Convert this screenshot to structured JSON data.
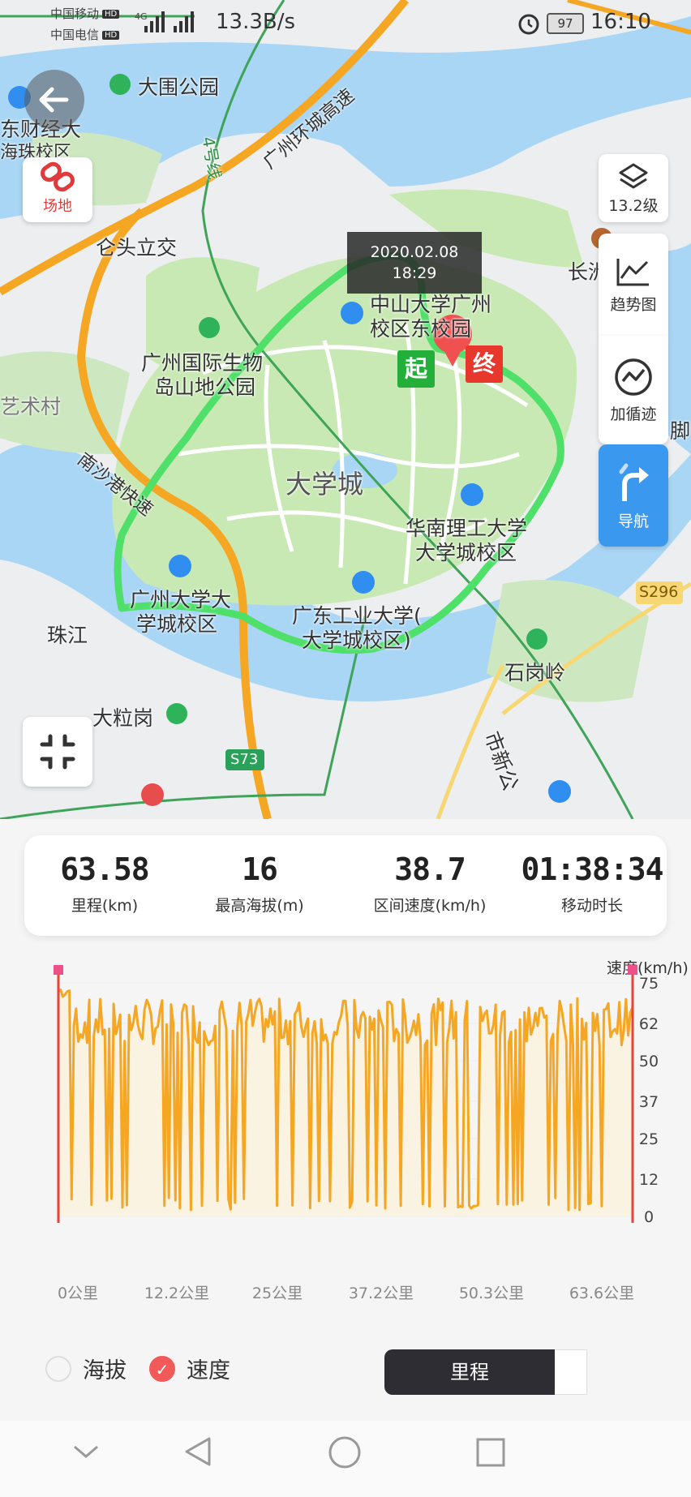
{
  "status_bar": {
    "carrier1": "中国移动",
    "carrier2": "中国电信",
    "hd": "HD",
    "net": "4G",
    "speed": "13.3B/s",
    "battery": "97",
    "time": "16:10"
  },
  "map": {
    "labels": {
      "park": "大围公园",
      "finance_school": "东财经大",
      "finance_school2": "海珠校区",
      "expressway": "广州环城高速",
      "metro4": "4号线",
      "interchange": "仑头立交",
      "biopark": "广州国际生物",
      "biopark2": "岛山地公园",
      "art_village": "艺术村",
      "nansha": "南沙港快速",
      "daxuecheng": "大学城",
      "scut": "华南理工大学",
      "scut2": "大学城校区",
      "gzhu": "广州大学大",
      "gzhu2": "学城校区",
      "gdut": "广东工业大学(",
      "gdut2": "大学城校区)",
      "sysu": "中山大学广州",
      "sysu2": "校区东校园",
      "pearl_river": "珠江",
      "daligang": "大粒岗",
      "shigangling": "石岗岭",
      "city_road": "市新公",
      "changzhou": "长洲",
      "jiao": "脚",
      "s73": "S73",
      "s296": "S296"
    },
    "venue_button_label": "场地",
    "tooltip_date": "2020.02.08",
    "tooltip_time": "18:29",
    "start_tag": "起",
    "end_tag": "终",
    "zoom_level": "13.2级",
    "panel": {
      "trend": "趋势图",
      "loop": "加循迹",
      "nav": "导航"
    }
  },
  "stats": [
    {
      "value": "63.58",
      "label": "里程(km)"
    },
    {
      "value": "16",
      "label": "最高海拔(m)"
    },
    {
      "value": "38.7",
      "label": "区间速度(km/h)"
    },
    {
      "value": "01:38:34",
      "label": "移动时长"
    }
  ],
  "chart_data": {
    "type": "line",
    "ylabel": "速度(km/h)",
    "yticks": [
      "75",
      "62",
      "50",
      "37",
      "25",
      "12",
      "0"
    ],
    "ylim": [
      0,
      75
    ],
    "xticks": [
      "0公里",
      "12.2公里",
      "25公里",
      "37.2公里",
      "50.3公里",
      "63.6公里"
    ],
    "xlim": [
      0,
      63.6
    ],
    "series": [
      {
        "name": "速度",
        "color": "#f5a623",
        "summary": {
          "typical_min": 55,
          "typical_max": 70,
          "dips_to": 2,
          "peak": 75
        }
      }
    ]
  },
  "legend": {
    "elevation": "海拔",
    "speed": "速度"
  },
  "toggle": {
    "mileage": "里程"
  }
}
